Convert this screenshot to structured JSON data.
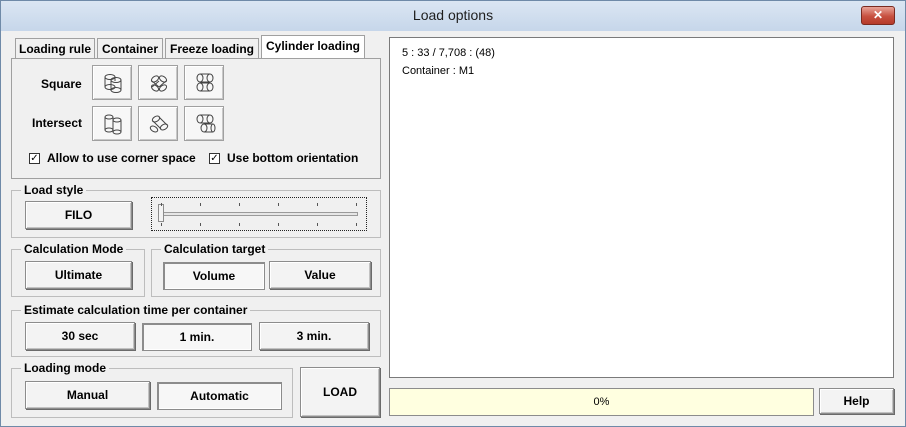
{
  "window": {
    "title": "Load options",
    "close_label": "✕"
  },
  "tabs": [
    {
      "label": "Loading rule"
    },
    {
      "label": "Container"
    },
    {
      "label": "Freeze loading"
    },
    {
      "label": "Cylinder loading",
      "active": true
    }
  ],
  "cylinder": {
    "square_label": "Square",
    "intersect_label": "Intersect",
    "corner_space": {
      "label": "Allow to use corner space",
      "checked": true,
      "mark": "✓"
    },
    "bottom_orientation": {
      "label": "Use bottom orientation",
      "checked": true,
      "mark": "✓"
    }
  },
  "load_style": {
    "label": "Load style",
    "button": "FILO",
    "slider_position": 0
  },
  "calc_mode": {
    "label": "Calculation Mode",
    "button": "Ultimate"
  },
  "calc_target": {
    "label": "Calculation target",
    "volume": "Volume",
    "value": "Value",
    "selected": "Volume"
  },
  "estimate": {
    "label": "Estimate calculation time per container",
    "options": [
      "30 sec",
      "1 min.",
      "3 min."
    ],
    "selected": "1 min."
  },
  "loading_mode": {
    "label": "Loading mode",
    "manual": "Manual",
    "automatic": "Automatic",
    "selected": "Automatic"
  },
  "load_button": "LOAD",
  "results": {
    "line1": "5 : 33 / 7,708 : (48)",
    "line2": "Container : M1"
  },
  "progress": {
    "text": "0%",
    "value": 0
  },
  "help_button": "Help",
  "colors": {
    "progress_bg": "#ffffe0",
    "titlebar": "#c6d6ea",
    "close": "#c75040"
  }
}
